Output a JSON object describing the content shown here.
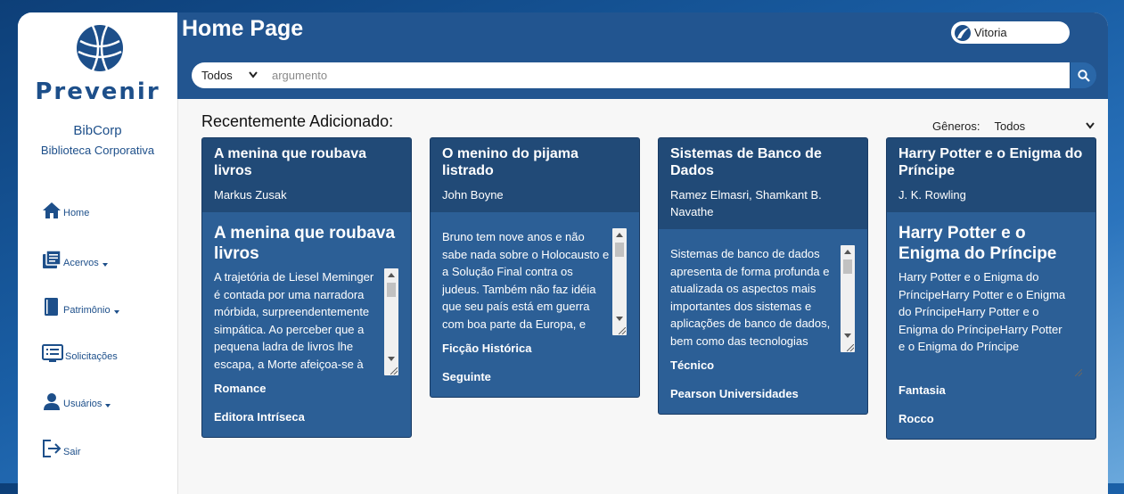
{
  "brand": {
    "name": "Prevenir",
    "library_name": "BibCorp",
    "library_subtitle": "Biblioteca Corporativa"
  },
  "sidebar": {
    "items": [
      {
        "label": "Home",
        "icon": "home-icon",
        "dropdown": false
      },
      {
        "label": "Acervos",
        "icon": "books-icon",
        "dropdown": true
      },
      {
        "label": "Patrimônio",
        "icon": "book-icon",
        "dropdown": true
      },
      {
        "label": "Solicitações",
        "icon": "list-icon",
        "dropdown": false
      },
      {
        "label": "Usuários",
        "icon": "user-icon",
        "dropdown": true
      },
      {
        "label": "Sair",
        "icon": "logout-icon",
        "dropdown": false
      }
    ]
  },
  "header": {
    "title": "Home Page",
    "user": {
      "name": "Vitoria"
    },
    "search": {
      "scope_selected": "Todos",
      "placeholder": "argumento",
      "value": ""
    }
  },
  "main": {
    "section_title": "Recentemente Adicionado:",
    "genre_filter": {
      "label": "Gêneros:",
      "selected": "Todos"
    },
    "books": [
      {
        "title": "A menina que roubava livros",
        "author": "Markus Zusak",
        "description": "A trajetória de Liesel Meminger é contada por uma narradora mórbida, surpreendentemente simpática. Ao perceber que a pequena ladra de livros lhe escapa, a Morte afeiçoa-se à menina",
        "genre": "Romance",
        "publisher": "Editora Intríseca",
        "big_title_visible": true
      },
      {
        "title": "O menino do pijama listrado",
        "author": "John Boyne",
        "description": "Bruno tem nove anos e não sabe nada sobre o Holocausto e a Solução Final contra os judeus. Também não faz idéia que seu país está em guerra com boa parte da Europa, e muito menos que sua família está envolvida",
        "genre": "Ficção Histórica",
        "publisher": "Seguinte",
        "big_title_visible": false
      },
      {
        "title": "Sistemas de Banco de Dados",
        "author": "Ramez Elmasri, Shamkant B. Navathe",
        "description": "Sistemas de banco de dados apresenta de forma profunda e atualizada os aspectos mais importantes dos sistemas e aplicações de banco de dados, bem como das tecnologias relacionadas. Essa edição",
        "genre": "Técnico",
        "publisher": "Pearson Universidades",
        "big_title_visible": false
      },
      {
        "title": "Harry Potter e o Enigma do Príncipe",
        "author": "J. K. Rowling",
        "description": "Harry Potter e o Enigma do PríncipeHarry Potter e o Enigma do PríncipeHarry Potter e o Enigma do PríncipeHarry Potter e o Enigma do Príncipe",
        "genre": "Fantasia",
        "publisher": "Rocco",
        "big_title_visible": true
      }
    ]
  }
}
